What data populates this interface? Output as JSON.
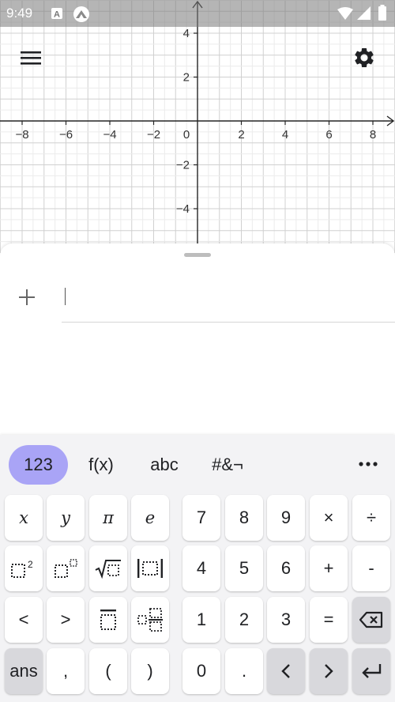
{
  "status_bar": {
    "time": "9:49",
    "icons": [
      "a-notification-icon",
      "app-notification-icon",
      "wifi-icon",
      "signal-icon",
      "battery-icon"
    ]
  },
  "graph": {
    "x_ticks": [
      "−8",
      "−6",
      "−4",
      "−2",
      "0",
      "2",
      "4",
      "6",
      "8"
    ],
    "y_ticks": [
      "4",
      "2",
      "−2",
      "−4"
    ],
    "grid": true,
    "axis_color": "#252525",
    "grid_color": "#d9d9d9"
  },
  "algebra": {
    "input_value": ""
  },
  "keyboard": {
    "tabs": [
      "123",
      "f(x)",
      "abc",
      "#&¬"
    ],
    "active_tab": "123",
    "accent_color": "#a9a4f6",
    "keys": {
      "x": "x",
      "y": "y",
      "pi": "π",
      "e": "e",
      "d7": "7",
      "d8": "8",
      "d9": "9",
      "times": "×",
      "divide": "÷",
      "d4": "4",
      "d5": "5",
      "d6": "6",
      "plus": "+",
      "minus": "-",
      "lt": "<",
      "gt": ">",
      "d1": "1",
      "d2": "2",
      "d3": "3",
      "equals": "=",
      "ans": "ans",
      "comma": ",",
      "lparen": "(",
      "rparen": ")",
      "d0": "0",
      "dot": "."
    }
  }
}
